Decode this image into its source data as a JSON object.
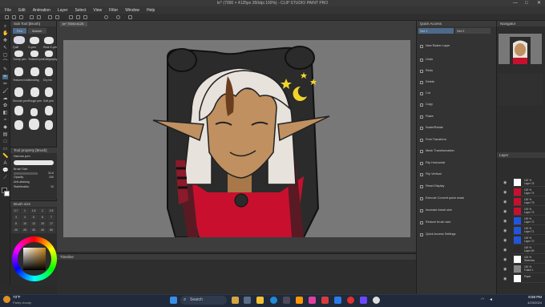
{
  "window": {
    "title": "lo^ (7000 × 4125px 350dpi 100%) - CLIP STUDIO PAINT PRO",
    "controls": [
      "—",
      "□",
      "✕"
    ]
  },
  "menu": [
    "File",
    "Edit",
    "Animation",
    "Layer",
    "Select",
    "View",
    "Filter",
    "Window",
    "Help"
  ],
  "subtool": {
    "header": "Sub Tool [Brush]",
    "tabs": [
      "Pen",
      "Marker"
    ],
    "brushes": [
      "Quill",
      "G-pen",
      "Real G-pen",
      "Turnip pen",
      "Textured pen",
      "Calligraphy",
      "Textured ink",
      "Blending",
      "Dry ink",
      "Smooth pen",
      "Rough pen",
      "Soft pen"
    ]
  },
  "tool_property": {
    "header": "Tool property [Brush]",
    "brush_name": "Narrow pen",
    "brush_size_label": "Brush Size",
    "brush_size": "34.6",
    "opacity_label": "Opacity",
    "opacity": "100",
    "blend_label": "Anti-aliasing",
    "stabilization_label": "Stabilization",
    "stabilization": "10"
  },
  "brush_size_palette": {
    "header": "Brush size",
    "values": [
      "0.7",
      "1",
      "1.5",
      "2",
      "2.5",
      "3",
      "4",
      "5",
      "6",
      "7",
      "8",
      "10",
      "12",
      "15",
      "17",
      "20",
      "25",
      "30",
      "40",
      "50"
    ]
  },
  "canvas_tab": "lo^ 7000×4125",
  "timeline": {
    "header": "Timeline"
  },
  "quick_access": {
    "header": "Quick Access",
    "set_label": "Set 1",
    "set2_label": "Set 2",
    "items": [
      "New Raster Layer",
      "Undo",
      "Redo",
      "Delete",
      "Cut",
      "Copy",
      "Paste",
      "Scale/Rotate",
      "Free Transform",
      "Mesh Transformation",
      "Flip Horizontal",
      "Flip Vertical",
      "Reset Display",
      "Execute Convert quick mask",
      "Increase brush size",
      "Reduce brush size",
      "Quick Access Settings"
    ]
  },
  "navigator": {
    "header": "Navigator"
  },
  "layers": {
    "header": "Layer",
    "items": [
      {
        "opacity": "100 %",
        "mode": "Normal",
        "name": "Layer 76"
      },
      {
        "opacity": "100 %",
        "mode": "Normal",
        "name": "Layer 74"
      },
      {
        "opacity": "100 %",
        "mode": "Normal",
        "name": "Layer 75"
      },
      {
        "opacity": "100 %",
        "mode": "Normal",
        "name": "Layer 73"
      },
      {
        "opacity": "100 %",
        "mode": "Normal",
        "name": "Layer 72"
      },
      {
        "opacity": "100 %",
        "mode": "Normal",
        "name": "Layer 71"
      },
      {
        "opacity": "100 %",
        "mode": "Normal",
        "name": "Layer 70"
      },
      {
        "opacity": "100 %",
        "mode": "Normal",
        "name": "Layer 69"
      },
      {
        "opacity": "100 %",
        "mode": "Normal",
        "name": "Sketches"
      },
      {
        "opacity": "100 %",
        "mode": "Normal",
        "name": "Folder 1"
      },
      {
        "opacity": "",
        "mode": "",
        "name": "Paper"
      }
    ]
  },
  "taskbar": {
    "weather_temp": "73°F",
    "weather_desc": "Partly cloudy",
    "search_placeholder": "Search",
    "time": "8:58 PM",
    "date": "4/23/2024"
  },
  "colors": {
    "accent_red": "#c8102e",
    "canvas_bg": "#787878",
    "skin": "#c09060",
    "hair": "#e8e2dc",
    "star": "#f2d32a",
    "bag_black": "#2b2b2b"
  }
}
